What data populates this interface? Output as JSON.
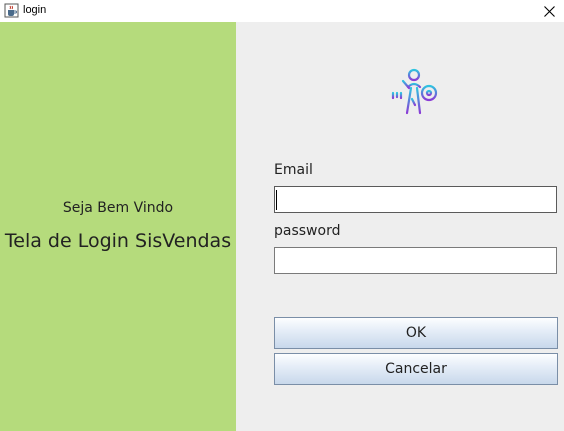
{
  "window": {
    "title": "login",
    "icon": "java-cup-icon",
    "close_icon": "close-icon"
  },
  "left_panel": {
    "background": "#b5db7c",
    "welcome_text": "Seja Bem Vindo",
    "title": "Tela de Login SisVendas"
  },
  "right_panel": {
    "background": "#eeeeee",
    "logo_icon": "person-key-icon",
    "email": {
      "label": "Email",
      "value": ""
    },
    "password": {
      "label": "password",
      "value": ""
    },
    "buttons": {
      "ok_label": "OK",
      "cancel_label": "Cancelar"
    }
  }
}
